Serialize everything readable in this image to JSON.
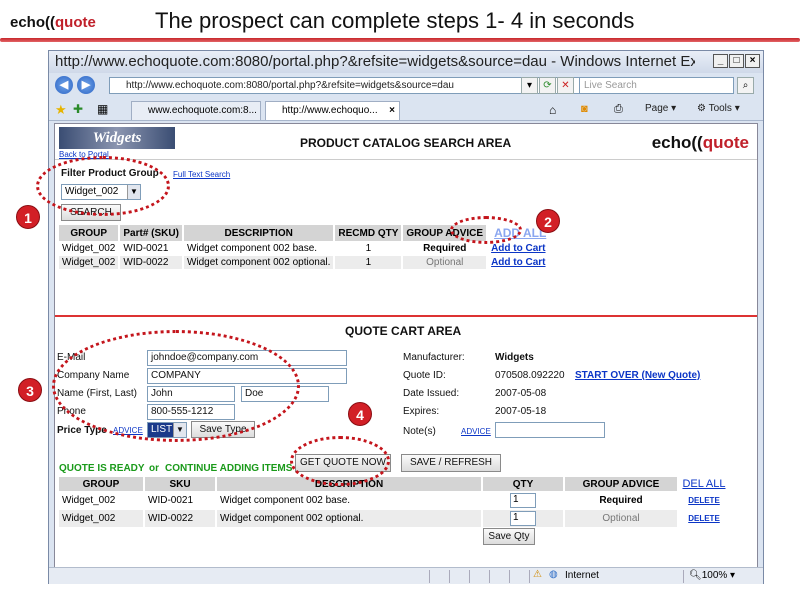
{
  "slide": {
    "logo_echo": "echo",
    "logo_quote": "quote",
    "title": "The prospect can complete steps 1- 4 in seconds"
  },
  "browser": {
    "window_title": "http://www.echoquote.com:8080/portal.php?&refsite=widgets&source=dau - Windows Internet Exp...",
    "address": "http://www.echoquote.com:8080/portal.php?&refsite=widgets&source=dau",
    "search_placeholder": "Live Search",
    "tabs": [
      {
        "label": "www.echoquote.com:8..."
      },
      {
        "label": "http://www.echoquo..."
      }
    ],
    "toolbar": {
      "page_label": "Page",
      "tools_label": "Tools"
    },
    "status": {
      "zone": "Internet",
      "zoom": "100%"
    }
  },
  "catalog": {
    "logo_text": "Widgets",
    "back_link": "Back to Portal",
    "title": "PRODUCT CATALOG SEARCH AREA",
    "filter_label": "Filter Product Group",
    "full_text_link": "Full Text Search",
    "group_value": "Widget_002",
    "search_button": "SEARCH",
    "add_all": "ADD ALL",
    "columns": [
      "GROUP",
      "Part# (SKU)",
      "DESCRIPTION",
      "RECMD QTY",
      "GROUP ADVICE"
    ],
    "rows": [
      {
        "group": "Widget_002",
        "sku": "WID-0021",
        "desc": "Widget component 002 base.",
        "qty": "1",
        "advice": "Required",
        "action": "Add to Cart"
      },
      {
        "group": "Widget_002",
        "sku": "WID-0022",
        "desc": "Widget component 002 optional.",
        "qty": "1",
        "advice": "Optional",
        "action": "Add to Cart"
      }
    ]
  },
  "cart": {
    "title": "QUOTE CART AREA",
    "labels": {
      "email": "E-Mail",
      "company": "Company Name",
      "name": "Name (First, Last)",
      "phone": "Phone",
      "price_type": "Price Type",
      "advice": "ADVICE",
      "manufacturer": "Manufacturer:",
      "quote_id": "Quote ID:",
      "date_issued": "Date Issued:",
      "expires": "Expires:",
      "notes": "Note(s)"
    },
    "values": {
      "email": "johndoe@company.com",
      "company": "COMPANY",
      "first": "John",
      "last": "Doe",
      "phone": "800-555-1212",
      "price_type": "LIST",
      "manufacturer": "Widgets",
      "quote_id": "070508.092220",
      "date_issued": "2007-05-08",
      "expires": "2007-05-18"
    },
    "save_type": "Save Type",
    "start_over": "START OVER (New Quote)",
    "notes_advice": "ADVICE",
    "ready_text": "QUOTE IS READY",
    "or_text": "or",
    "continue_text": "CONTINUE ADDING ITEMS",
    "get_quote": "GET QUOTE NOW",
    "save_refresh": "SAVE / REFRESH",
    "columns": [
      "GROUP",
      "SKU",
      "DESCRIPTION",
      "QTY",
      "GROUP ADVICE"
    ],
    "del_all": "DEL ALL",
    "rows": [
      {
        "group": "Widget_002",
        "sku": "WID-0021",
        "desc": "Widget component 002 base.",
        "qty": "1",
        "advice": "Required",
        "delete": "DELETE"
      },
      {
        "group": "Widget_002",
        "sku": "WID-0022",
        "desc": "Widget component 002 optional.",
        "qty": "1",
        "advice": "Optional",
        "delete": "DELETE"
      }
    ],
    "save_qty": "Save Qty"
  },
  "callouts": [
    "1",
    "2",
    "3",
    "4"
  ],
  "colors": {
    "accent_red": "#d21f26",
    "link_blue": "#0b35c6",
    "ready_green": "#1a9a1a"
  }
}
